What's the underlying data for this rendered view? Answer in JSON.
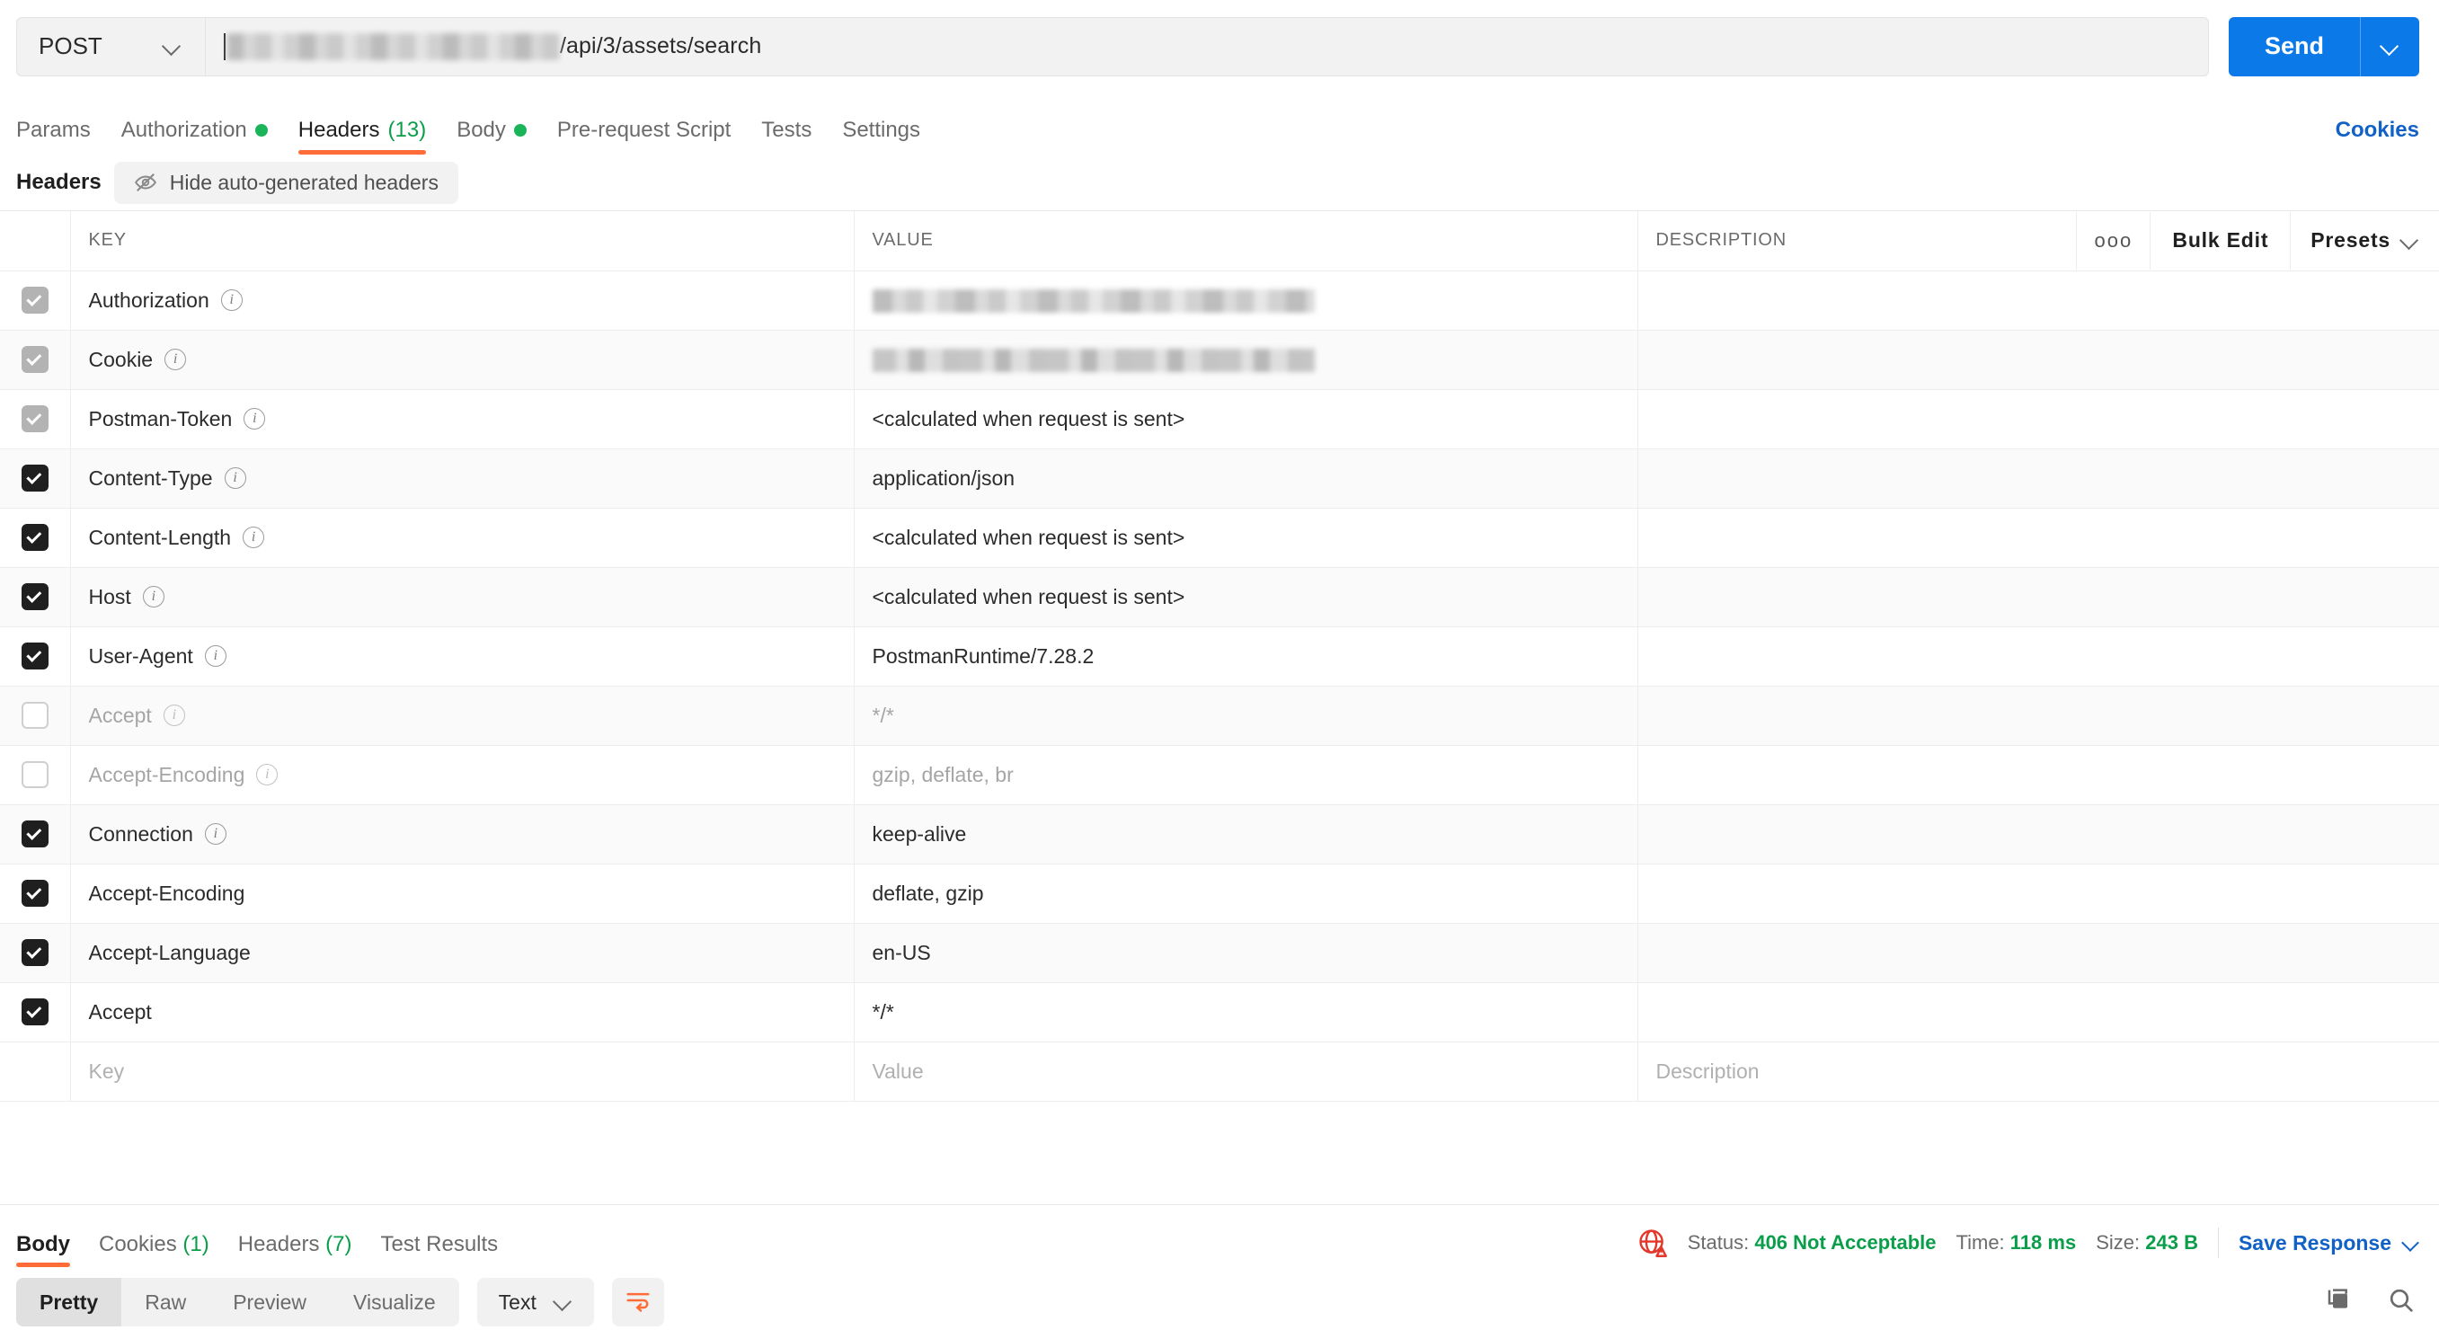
{
  "request": {
    "method": "POST",
    "url_prefix_redacted": true,
    "url_suffix": "/api/3/assets/search",
    "send_label": "Send"
  },
  "request_tabs": [
    {
      "label": "Params",
      "active": false,
      "dot": false,
      "count": null
    },
    {
      "label": "Authorization",
      "active": false,
      "dot": true,
      "count": null
    },
    {
      "label": "Headers",
      "active": true,
      "dot": false,
      "count": "(13)"
    },
    {
      "label": "Body",
      "active": false,
      "dot": true,
      "count": null
    },
    {
      "label": "Pre-request Script",
      "active": false,
      "dot": false,
      "count": null
    },
    {
      "label": "Tests",
      "active": false,
      "dot": false,
      "count": null
    },
    {
      "label": "Settings",
      "active": false,
      "dot": false,
      "count": null
    }
  ],
  "cookies_link": "Cookies",
  "headers_section": {
    "title": "Headers",
    "toggle_label": "Hide auto-generated headers",
    "columns": {
      "key": "KEY",
      "value": "VALUE",
      "description": "DESCRIPTION"
    },
    "actions": {
      "more": "ooo",
      "bulk_edit": "Bulk Edit",
      "presets": "Presets"
    },
    "rows": [
      {
        "checked": true,
        "locked": true,
        "key": "Authorization",
        "info": true,
        "value": "",
        "value_redacted": true,
        "description": ""
      },
      {
        "checked": true,
        "locked": true,
        "key": "Cookie",
        "info": true,
        "value": "",
        "value_redacted": true,
        "description": ""
      },
      {
        "checked": true,
        "locked": true,
        "key": "Postman-Token",
        "info": true,
        "value": "<calculated when request is sent>",
        "value_redacted": false,
        "description": ""
      },
      {
        "checked": true,
        "locked": false,
        "key": "Content-Type",
        "info": true,
        "value": "application/json",
        "value_redacted": false,
        "description": ""
      },
      {
        "checked": true,
        "locked": false,
        "key": "Content-Length",
        "info": true,
        "value": "<calculated when request is sent>",
        "value_redacted": false,
        "description": ""
      },
      {
        "checked": true,
        "locked": false,
        "key": "Host",
        "info": true,
        "value": "<calculated when request is sent>",
        "value_redacted": false,
        "description": ""
      },
      {
        "checked": true,
        "locked": false,
        "key": "User-Agent",
        "info": true,
        "value": "PostmanRuntime/7.28.2",
        "value_redacted": false,
        "description": ""
      },
      {
        "checked": false,
        "locked": false,
        "key": "Accept",
        "info": true,
        "value": "*/*",
        "value_redacted": false,
        "description": ""
      },
      {
        "checked": false,
        "locked": false,
        "key": "Accept-Encoding",
        "info": true,
        "value": "gzip, deflate, br",
        "value_redacted": false,
        "description": ""
      },
      {
        "checked": true,
        "locked": false,
        "key": "Connection",
        "info": true,
        "value": "keep-alive",
        "value_redacted": false,
        "description": ""
      },
      {
        "checked": true,
        "locked": false,
        "key": "Accept-Encoding",
        "info": false,
        "value": "deflate, gzip",
        "value_redacted": false,
        "description": ""
      },
      {
        "checked": true,
        "locked": false,
        "key": "Accept-Language",
        "info": false,
        "value": "en-US",
        "value_redacted": false,
        "description": ""
      },
      {
        "checked": true,
        "locked": false,
        "key": "Accept",
        "info": false,
        "value": "*/*",
        "value_redacted": false,
        "description": ""
      }
    ],
    "new_row": {
      "key_placeholder": "Key",
      "value_placeholder": "Value",
      "description_placeholder": "Description"
    }
  },
  "response": {
    "tabs": [
      {
        "label": "Body",
        "active": true,
        "count": null
      },
      {
        "label": "Cookies",
        "active": false,
        "count": "(1)"
      },
      {
        "label": "Headers",
        "active": false,
        "count": "(7)"
      },
      {
        "label": "Test Results",
        "active": false,
        "count": null
      }
    ],
    "status_label": "Status:",
    "status_value": "406 Not Acceptable",
    "time_label": "Time:",
    "time_value": "118 ms",
    "size_label": "Size:",
    "size_value": "243 B",
    "save_response": "Save Response",
    "view_modes": [
      {
        "label": "Pretty",
        "active": true
      },
      {
        "label": "Raw",
        "active": false
      },
      {
        "label": "Preview",
        "active": false
      },
      {
        "label": "Visualize",
        "active": false
      }
    ],
    "format": "Text"
  },
  "colors": {
    "accent_orange": "#ff6c37",
    "send_blue": "#0b79e8",
    "link_blue": "#1161c7",
    "green": "#0a9e4a",
    "dot_green": "#1bb45a",
    "status_red": "#e2372a"
  }
}
